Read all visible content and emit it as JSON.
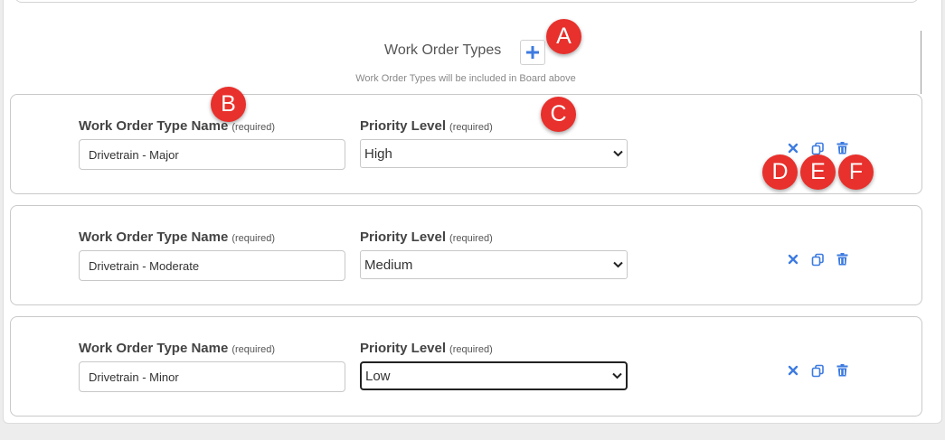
{
  "section": {
    "title": "Work Order Types",
    "subtitle": "Work Order Types will be included in Board above"
  },
  "labels": {
    "name": "Work Order Type Name",
    "priority": "Priority Level",
    "required": "(required)"
  },
  "work_order_types": [
    {
      "name": "Drivetrain - Major",
      "priority": "High"
    },
    {
      "name": "Drivetrain - Moderate",
      "priority": "Medium"
    },
    {
      "name": "Drivetrain - Minor",
      "priority": "Low"
    }
  ],
  "callouts": {
    "a": "A",
    "b": "B",
    "c": "C",
    "d": "D",
    "e": "E",
    "f": "F"
  },
  "icons": {
    "add": "plus-icon",
    "remove": "close-icon",
    "duplicate": "copy-icon",
    "delete": "trash-icon"
  },
  "colors": {
    "accent": "#3d7be0",
    "callout": "#e8302c"
  }
}
